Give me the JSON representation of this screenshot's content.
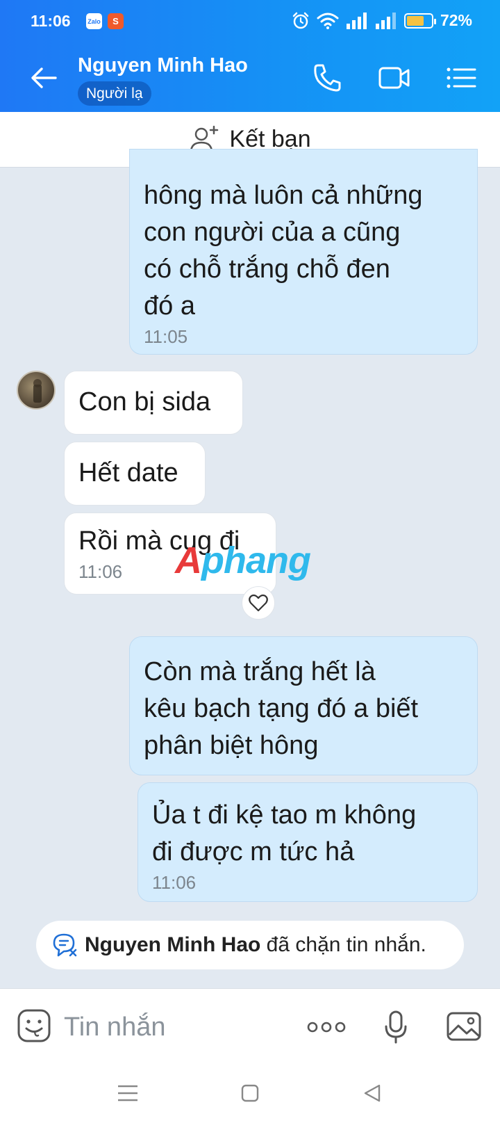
{
  "status_bar": {
    "time": "11:06",
    "apps": [
      "Zalo",
      "S"
    ],
    "battery": "72%",
    "battery_level": 0.72
  },
  "header": {
    "name": "Nguyen Minh Hao",
    "badge": "Người lạ",
    "icons": [
      "back-arrow-icon",
      "phone-icon",
      "video-camera-icon",
      "menu-list-icon"
    ]
  },
  "add_friend": {
    "label": "Kết bạn",
    "icon": "add-person-icon"
  },
  "messages": [
    {
      "dir": "out",
      "lines": [
        "hông mà luôn cả những",
        "con người của a cũng",
        "có chỗ trắng chỗ đen",
        "đó a"
      ],
      "time": "11:05"
    },
    {
      "dir": "in",
      "lines": [
        "Con bị sida"
      ]
    },
    {
      "dir": "in",
      "lines": [
        "Hết date"
      ]
    },
    {
      "dir": "in",
      "lines": [
        "Rồi mà cug đi"
      ],
      "time": "11:06"
    },
    {
      "dir": "out",
      "lines": [
        "Còn mà trắng hết là",
        "kêu bạch tạng đó a biết",
        "phân biệt hông"
      ]
    },
    {
      "dir": "out",
      "lines": [
        "Ủa t đi kệ tao m không",
        "đi được m tức hả"
      ],
      "time": "11:06"
    }
  ],
  "watermark": {
    "first": "A",
    "rest": "phang"
  },
  "blocked": {
    "name": "Nguyen Minh Hao",
    "text": " đã chặn tin nhắn."
  },
  "composer": {
    "placeholder": "Tin nhắn"
  },
  "colors": {
    "header": "#1f78f5",
    "out_bubble": "#d4ecfd",
    "in_bubble": "#ffffff",
    "chat_bg": "#e2e9f1"
  }
}
